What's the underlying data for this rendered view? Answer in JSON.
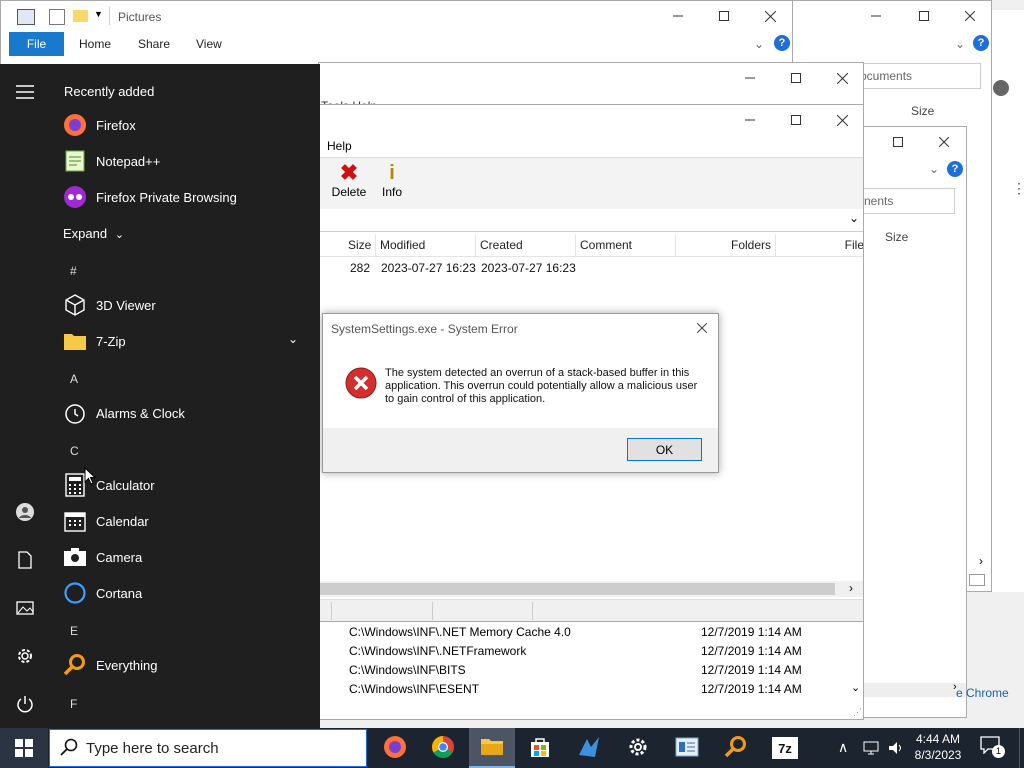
{
  "explorer_main": {
    "title": "Pictures",
    "tabs": [
      "File",
      "Home",
      "Share",
      "View"
    ]
  },
  "explorer_back": {
    "address_text": "ocuments",
    "size_header": "Size"
  },
  "explorer_mid": {
    "address_text": "nents",
    "size_header": "Size",
    "chrome_text": "e Chrome"
  },
  "sevenzip_back": {
    "menu_partial": "Tools   Help"
  },
  "sevenzip_front": {
    "menu_help": "Help",
    "toolbar": {
      "delete_label": "Delete",
      "info_label": "Info"
    },
    "columns": [
      "Size",
      "Modified",
      "Created",
      "Comment",
      "Folders",
      "File"
    ],
    "row": {
      "size": "282",
      "modified": "2023-07-27 16:23",
      "created": "2023-07-27 16:23"
    }
  },
  "everything": {
    "rows": [
      {
        "path": "C:\\Windows\\INF\\.NET Memory Cache 4.0",
        "date": "12/7/2019 1:14 AM"
      },
      {
        "path": "C:\\Windows\\INF\\.NETFramework",
        "date": "12/7/2019 1:14 AM"
      },
      {
        "path": "C:\\Windows\\INF\\BITS",
        "date": "12/7/2019 1:14 AM"
      },
      {
        "path": "C:\\Windows\\INF\\ESENT",
        "date": "12/7/2019 1:14 AM"
      }
    ]
  },
  "dialog": {
    "title": "SystemSettings.exe - System Error",
    "message": "The system detected an overrun of a stack-based buffer in this application. This overrun could potentially allow a malicious user to gain control of this application.",
    "ok_label": "OK"
  },
  "start_menu": {
    "recently_added": "Recently added",
    "recent": [
      "Firefox",
      "Notepad++",
      "Firefox Private Browsing"
    ],
    "expand_label": "Expand",
    "letters": {
      "hash": "#",
      "a": "A",
      "c": "C",
      "e": "E",
      "f": "F"
    },
    "apps": {
      "viewer3d": "3D Viewer",
      "zip7": "7-Zip",
      "alarms": "Alarms & Clock",
      "calculator": "Calculator",
      "calendar": "Calendar",
      "camera": "Camera",
      "cortana": "Cortana",
      "everything": "Everything"
    }
  },
  "taskbar": {
    "search_placeholder": "Type here to search",
    "time": "4:44 AM",
    "date": "8/3/2023",
    "notification_count": "1"
  },
  "colors": {
    "accent": "#0078d7",
    "start_bg": "#1f1f1f",
    "taskbar_bg": "#1c2430",
    "error_red": "#d32f2f"
  }
}
